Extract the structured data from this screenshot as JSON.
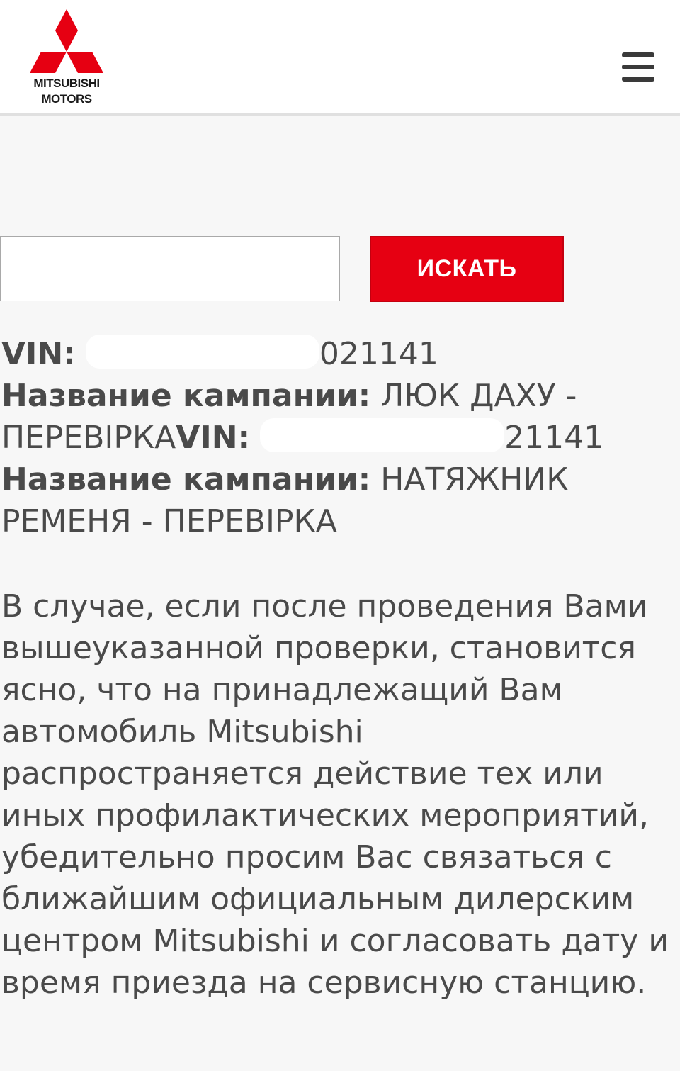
{
  "header": {
    "logo_line1": "MITSUBISHI",
    "logo_line2": "MOTORS",
    "logo_icon": "three-diamonds-icon",
    "menu_icon": "hamburger-menu-icon"
  },
  "search": {
    "value": "",
    "button_label": "ИСКАТЬ"
  },
  "results": {
    "vin_label": "VIN:",
    "campaign_label": "Название кампании:",
    "items": [
      {
        "vin_visible": "021141",
        "campaign": "ЛЮК ДАХУ - ПЕРЕВІРКА"
      },
      {
        "vin_visible": "21141",
        "campaign": "НАТЯЖНИК РЕМЕНЯ - ПЕРЕВІРКА"
      }
    ]
  },
  "info_text": "В случае, если после проведения Вами вышеуказанной проверки, становится ясно, что на принадлежащий Вам автомобиль Mitsubishi распространяется действие тех или иных профилактических мероприятий, убедительно просим Вас связаться с ближайшим официальным дилерским центром Mitsubishi и согласовать дату и время приезда на сервисную станцию.",
  "colors": {
    "brand_red": "#e60012",
    "text": "#4a4a4a",
    "background": "#f7f7f7"
  }
}
